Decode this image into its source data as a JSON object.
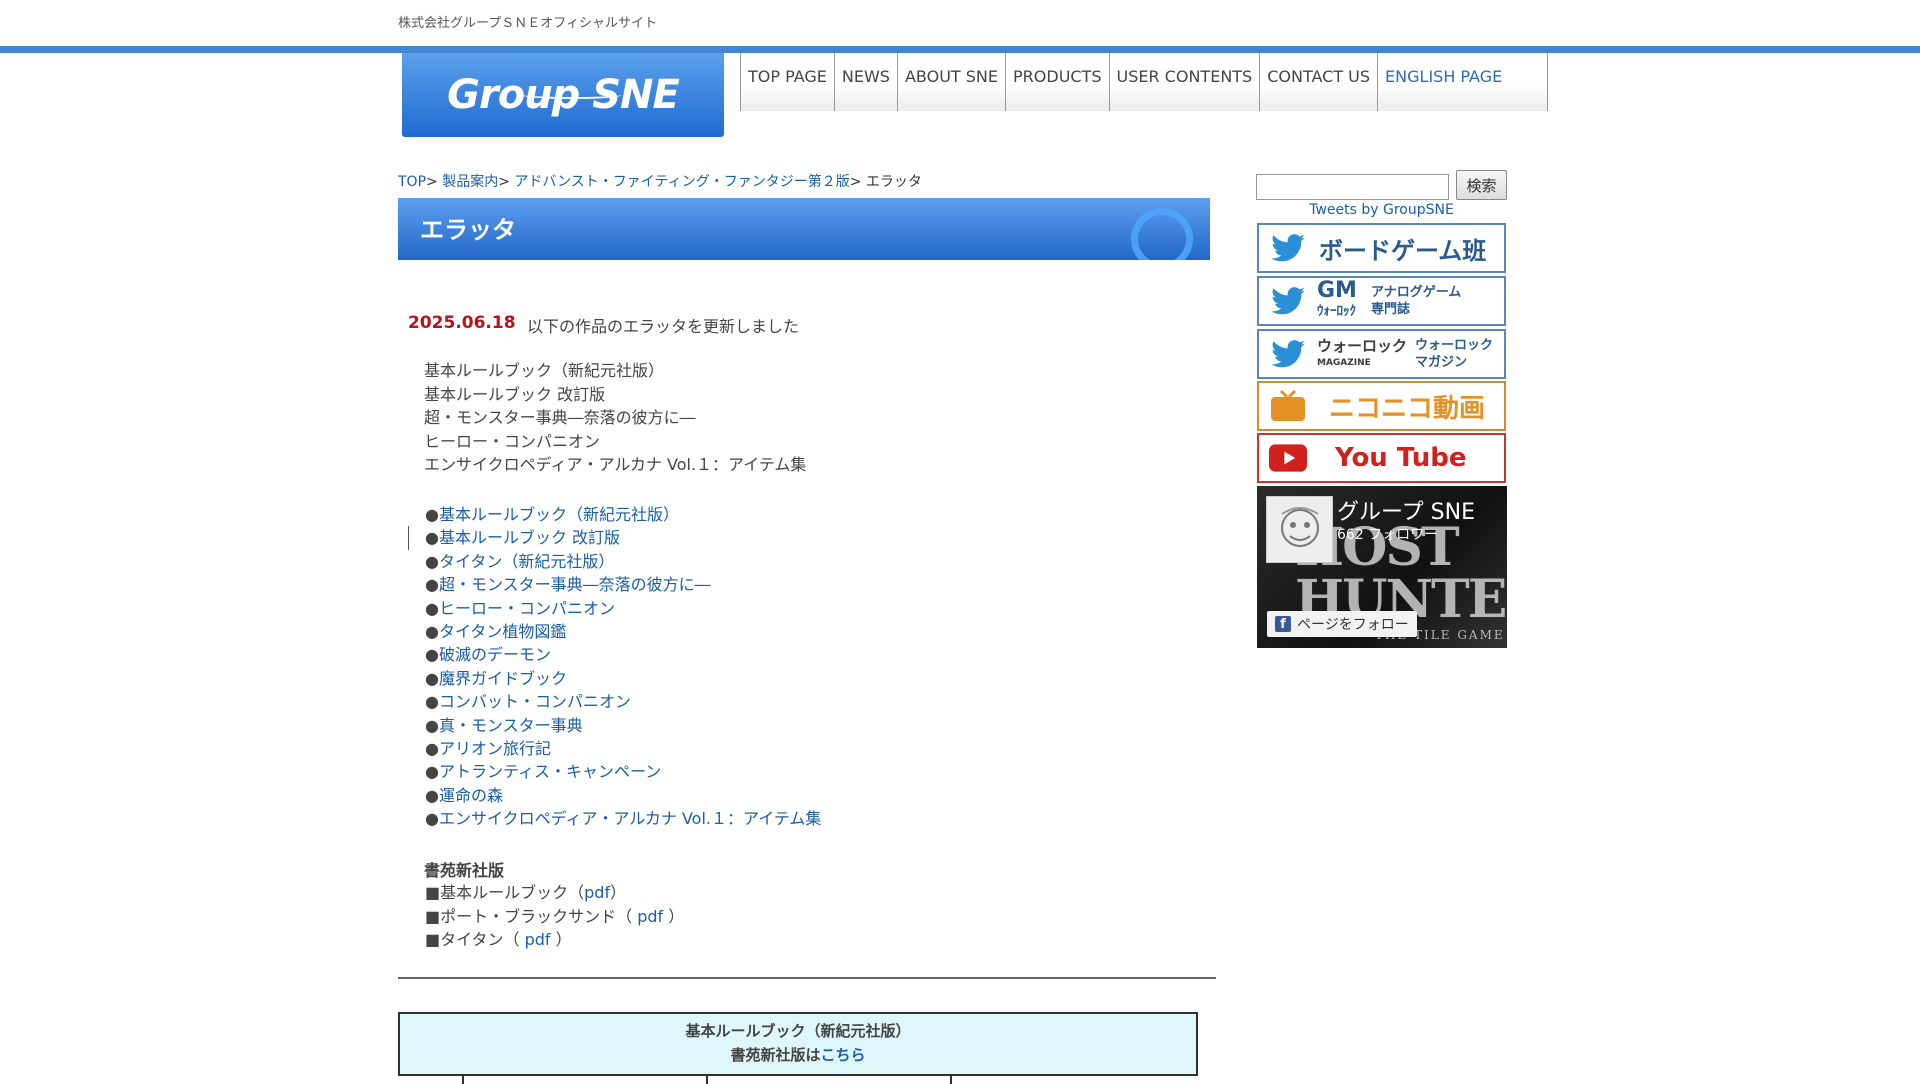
{
  "site": {
    "tagline": "株式会社グループＳＮＥオフィシャルサイト",
    "logo_text": "Group SNE"
  },
  "nav": [
    "TOP PAGE",
    "NEWS",
    "ABOUT SNE",
    "PRODUCTS",
    "USER CONTENTS",
    "CONTACT US",
    "ENGLISH PAGE"
  ],
  "breadcrumb": {
    "top": "TOP",
    "products": "製品案内",
    "series": "アドバンスト・ファイティング・ファンタジー第２版",
    "current": "エラッタ",
    "separator": ">"
  },
  "page": {
    "title": "エラッタ",
    "date": "2025.06.18",
    "update_text": "以下の作品のエラッタを更新しました",
    "updated_list": [
      "基本ルールブック（新紀元社版）",
      "基本ルールブック 改訂版",
      "超・モンスター事典―奈落の彼方に―",
      "ヒーロー・コンパニオン",
      "エンサイクロペディア・アルカナ Vol.１：アイテム集"
    ],
    "bullet": "●",
    "links": [
      "基本ルールブック（新紀元社版）",
      "基本ルールブック 改訂版",
      "タイタン（新紀元社版）",
      "超・モンスター事典―奈落の彼方に―",
      "ヒーロー・コンパニオン",
      "タイタン植物図鑑",
      "破滅のデーモン",
      "魔界ガイドブック",
      "コンバット・コンパニオン",
      "真・モンスター事典",
      "アリオン旅行記",
      "アトランティス・キャンペーン",
      "運命の森",
      "エンサイクロペディア・アルカナ Vol.１：アイテム集"
    ],
    "shoen": {
      "title": "書苑新社版",
      "square": "■",
      "items": [
        {
          "before": "基本ルールブック（",
          "link": "pdf",
          "after": "）"
        },
        {
          "before": "ポート・ブラックサンド（ ",
          "link": "pdf",
          "after": " ）"
        },
        {
          "before": "タイタン（ ",
          "link": "pdf",
          "after": " ）"
        }
      ]
    },
    "table": {
      "line1": "基本ルールブック（新紀元社版）",
      "line2_text": "書苑新社版は",
      "line2_link": "こちら"
    }
  },
  "sidebar": {
    "search_button": "検索",
    "tweets_link": "Tweets by GroupSNE",
    "buttons": {
      "boardgame": "ボードゲーム班",
      "gm_logo": "GM",
      "gm_logo_sub": "ｳｫｰﾛｯｸ",
      "gm_text_1": "アナログゲーム",
      "gm_text_2": "専門誌",
      "warlock_logo": "ウォーロック",
      "warlock_logo_sub": "MAGAZINE",
      "warlock_text_1": "ウォーロック",
      "warlock_text_2": "マガジン",
      "nico": "ニコニコ動画",
      "youtube": "You Tube"
    },
    "facebook": {
      "name": "グループ SNE",
      "followers": "662 フォロワー",
      "follow_button": "ページをフォロー",
      "cover_text_1": "HOST",
      "cover_text_2": "HUNTER",
      "cover_tag": "THE TILE GAME"
    },
    "colors": {
      "twitter_blue": "#2a8fd6",
      "nico_orange": "#e69125",
      "youtube_red": "#d2211c"
    }
  }
}
